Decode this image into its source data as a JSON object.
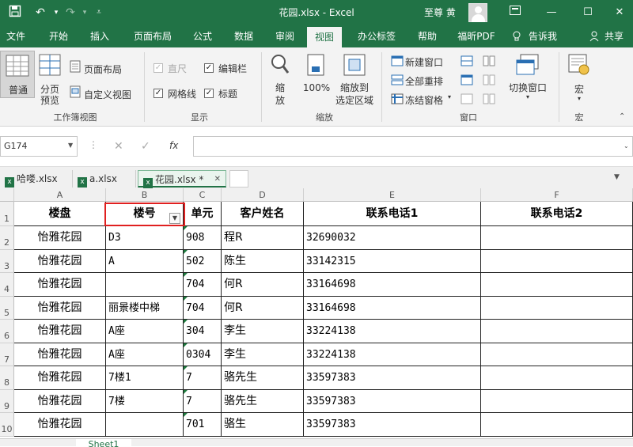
{
  "window": {
    "title": "花园.xlsx  -  Excel",
    "user": "至尊 黄",
    "quick_access": [
      "save-icon",
      "undo-icon",
      "redo-icon",
      "customize-icon"
    ],
    "controls": [
      "ribbon-display-icon",
      "minimize-icon",
      "maximize-icon",
      "close-icon"
    ]
  },
  "tabs": {
    "file": "文件",
    "home": "开始",
    "insert": "插入",
    "layout": "页面布局",
    "formulas": "公式",
    "data": "数据",
    "review": "审阅",
    "view": "视图",
    "office_tab": "办公标签",
    "help": "帮助",
    "foxit": "福昕PDF",
    "tell_me": "告诉我",
    "share": "共享"
  },
  "ribbon": {
    "workbook_views": {
      "normal": "普通",
      "page_break_line1": "分页",
      "page_break_line2": "预览",
      "page_layout": "页面布局",
      "custom_views": "自定义视图",
      "group_label": "工作簿视图"
    },
    "show": {
      "ruler": "直尺",
      "formula_bar": "编辑栏",
      "gridlines": "网格线",
      "headings": "标题",
      "group_label": "显示"
    },
    "zoom": {
      "zoom_line1": "缩",
      "zoom_line2": "放",
      "zoom_100": "100%",
      "zoom_selection_line1": "缩放到",
      "zoom_selection_line2": "选定区域",
      "group_label": "缩放"
    },
    "window": {
      "new_window": "新建窗口",
      "arrange_all": "全部重排",
      "freeze_panes": "冻结窗格",
      "switch_windows": "切换窗口",
      "group_label": "窗口"
    },
    "macros": {
      "macros": "宏",
      "group_label": "宏"
    }
  },
  "formula_bar": {
    "name_box": "G174",
    "cancel": "✕",
    "enter": "✓",
    "fx": "fx",
    "content": ""
  },
  "file_tabs": [
    "哈喽.xlsx",
    "a.xlsx",
    "花园.xlsx *"
  ],
  "columns": [
    "A",
    "B",
    "C",
    "D",
    "E",
    "F"
  ],
  "rows": [
    "1",
    "2",
    "3",
    "4",
    "5",
    "6",
    "7",
    "8",
    "9",
    "10"
  ],
  "table": {
    "headers": [
      "楼盘",
      "楼号",
      "单元",
      "客户姓名",
      "联系电话1",
      "联系电话2"
    ],
    "data": [
      [
        "怡雅花园",
        "D3",
        "908",
        "程R",
        "32690032",
        ""
      ],
      [
        "怡雅花园",
        "A",
        "502",
        "陈生",
        "33142315",
        ""
      ],
      [
        "怡雅花园",
        "",
        "704",
        "何R",
        "33164698",
        ""
      ],
      [
        "怡雅花园",
        "丽景楼中梯",
        "704",
        "何R",
        "33164698",
        ""
      ],
      [
        "怡雅花园",
        "A座",
        "304",
        "李生",
        "33224138",
        ""
      ],
      [
        "怡雅花园",
        "A座",
        "0304",
        "李生",
        "33224138",
        ""
      ],
      [
        "怡雅花园",
        "7楼1",
        "7",
        "骆先生",
        "33597383",
        ""
      ],
      [
        "怡雅花园",
        "7楼",
        "7",
        "骆先生",
        "33597383",
        ""
      ],
      [
        "怡雅花园",
        "",
        "701",
        "骆生",
        "33597383",
        ""
      ]
    ]
  },
  "sheet_tab": "Sheet1",
  "colors": {
    "accent": "#217346",
    "highlight": "#e02020"
  }
}
